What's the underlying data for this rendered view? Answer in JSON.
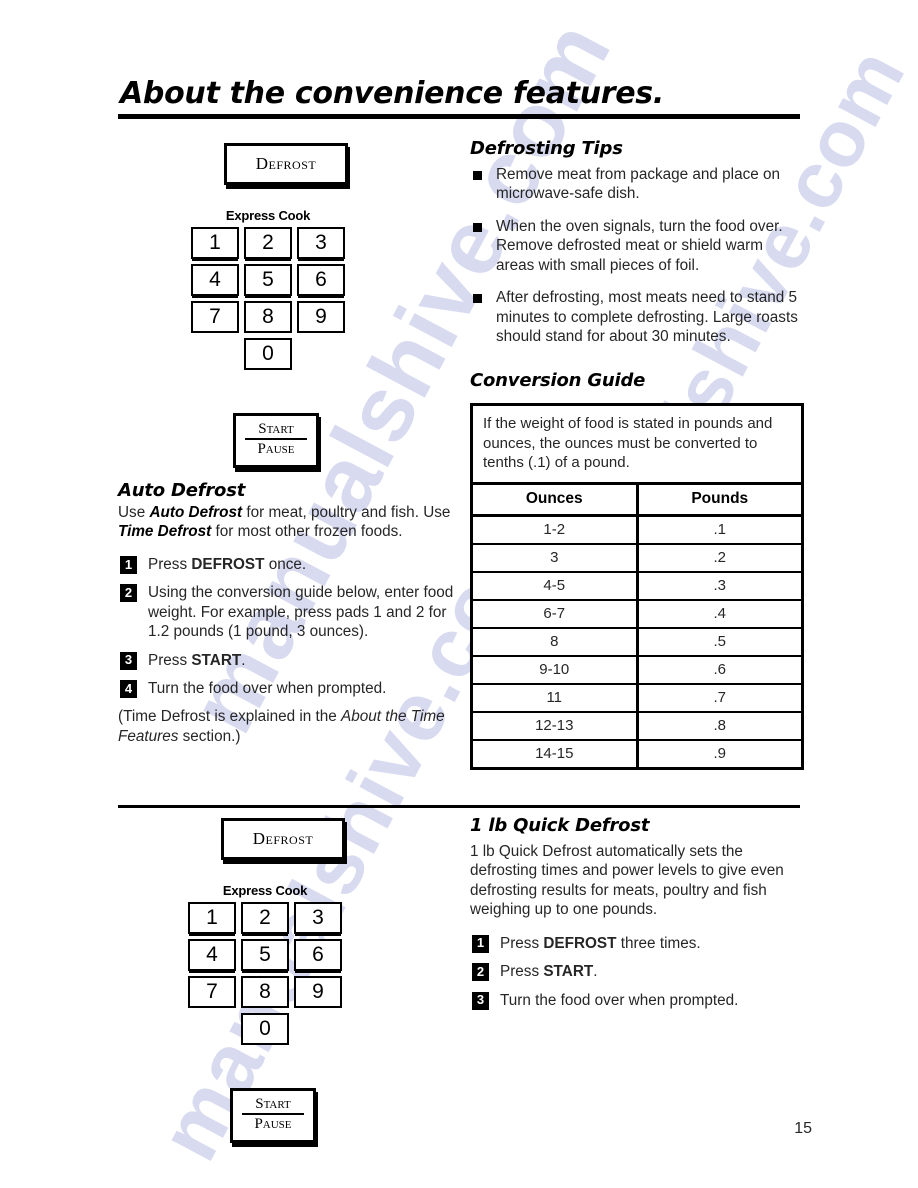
{
  "document": {
    "title": "About the convenience features.",
    "page_number": "15",
    "watermark": "manualshive.com"
  },
  "control_panel_top": {
    "defrost_button_label": "Defrost",
    "express_cook_label": "Express Cook",
    "keys": [
      "1",
      "2",
      "3",
      "4",
      "5",
      "6",
      "7",
      "8",
      "9"
    ],
    "zero_key": "0",
    "start_label": "Start",
    "pause_label": "Pause"
  },
  "control_panel_bottom": {
    "defrost_button_label": "Defrost",
    "express_cook_label": "Express Cook",
    "keys": [
      "1",
      "2",
      "3",
      "4",
      "5",
      "6",
      "7",
      "8",
      "9"
    ],
    "zero_key": "0",
    "start_label": "Start",
    "pause_label": "Pause"
  },
  "auto_defrost": {
    "heading": "Auto Defrost",
    "intro_line_1_a": "Use ",
    "intro_line_1_b": "Auto Defrost",
    "intro_line_1_c": " for meat, poultry and fish.",
    "intro_line_2_a": "Use ",
    "intro_line_2_b": "Time Defrost",
    "intro_line_2_c": " for most other frozen foods.",
    "steps": [
      {
        "num": "1",
        "text_a": "Press ",
        "text_b": "DEFROST",
        "text_c": " once."
      },
      {
        "num": "2",
        "text_a": "Using the conversion guide below, enter food weight. For example, press pads 1 and 2 for 1.2 pounds (1 pound, 3 ounces).",
        "text_b": "",
        "text_c": ""
      },
      {
        "num": "3",
        "text_a": "Press ",
        "text_b": "START",
        "text_c": "."
      },
      {
        "num": "4",
        "text_a": "Turn the food over when prompted.",
        "text_b": "",
        "text_c": ""
      }
    ],
    "note_a": "(Time Defrost is explained in the ",
    "note_b": "About the Time Features",
    "note_c": " section.)"
  },
  "defrosting_tips": {
    "heading": "Defrosting Tips",
    "items": [
      "Remove meat from package and place on microwave-safe dish.",
      "When the oven signals, turn the food over. Remove defrosted meat or shield warm areas with small pieces of foil.",
      "After defrosting, most meats need to stand 5 minutes to complete defrosting. Large roasts should stand for about 30 minutes."
    ]
  },
  "conversion_guide": {
    "heading": "Conversion Guide",
    "intro": "If the weight of food is stated in pounds and ounces, the ounces must be converted to tenths (.1) of a pound.",
    "columns": [
      "Ounces",
      "Pounds"
    ],
    "rows": [
      [
        "1-2",
        ".1"
      ],
      [
        "3",
        ".2"
      ],
      [
        "4-5",
        ".3"
      ],
      [
        "6-7",
        ".4"
      ],
      [
        "8",
        ".5"
      ],
      [
        "9-10",
        ".6"
      ],
      [
        "11",
        ".7"
      ],
      [
        "12-13",
        ".8"
      ],
      [
        "14-15",
        ".9"
      ]
    ]
  },
  "quick_defrost": {
    "heading": "1 lb Quick Defrost",
    "intro": "1 lb Quick Defrost automatically sets the defrosting times and power levels to give even defrosting results for meats, poultry and fish weighing up to one pounds.",
    "steps": [
      {
        "num": "1",
        "text_a": "Press ",
        "text_b": "DEFROST",
        "text_c": " three times."
      },
      {
        "num": "2",
        "text_a": "Press ",
        "text_b": "START",
        "text_c": "."
      },
      {
        "num": "3",
        "text_a": "Turn the food over when prompted.",
        "text_b": "",
        "text_c": ""
      }
    ]
  }
}
